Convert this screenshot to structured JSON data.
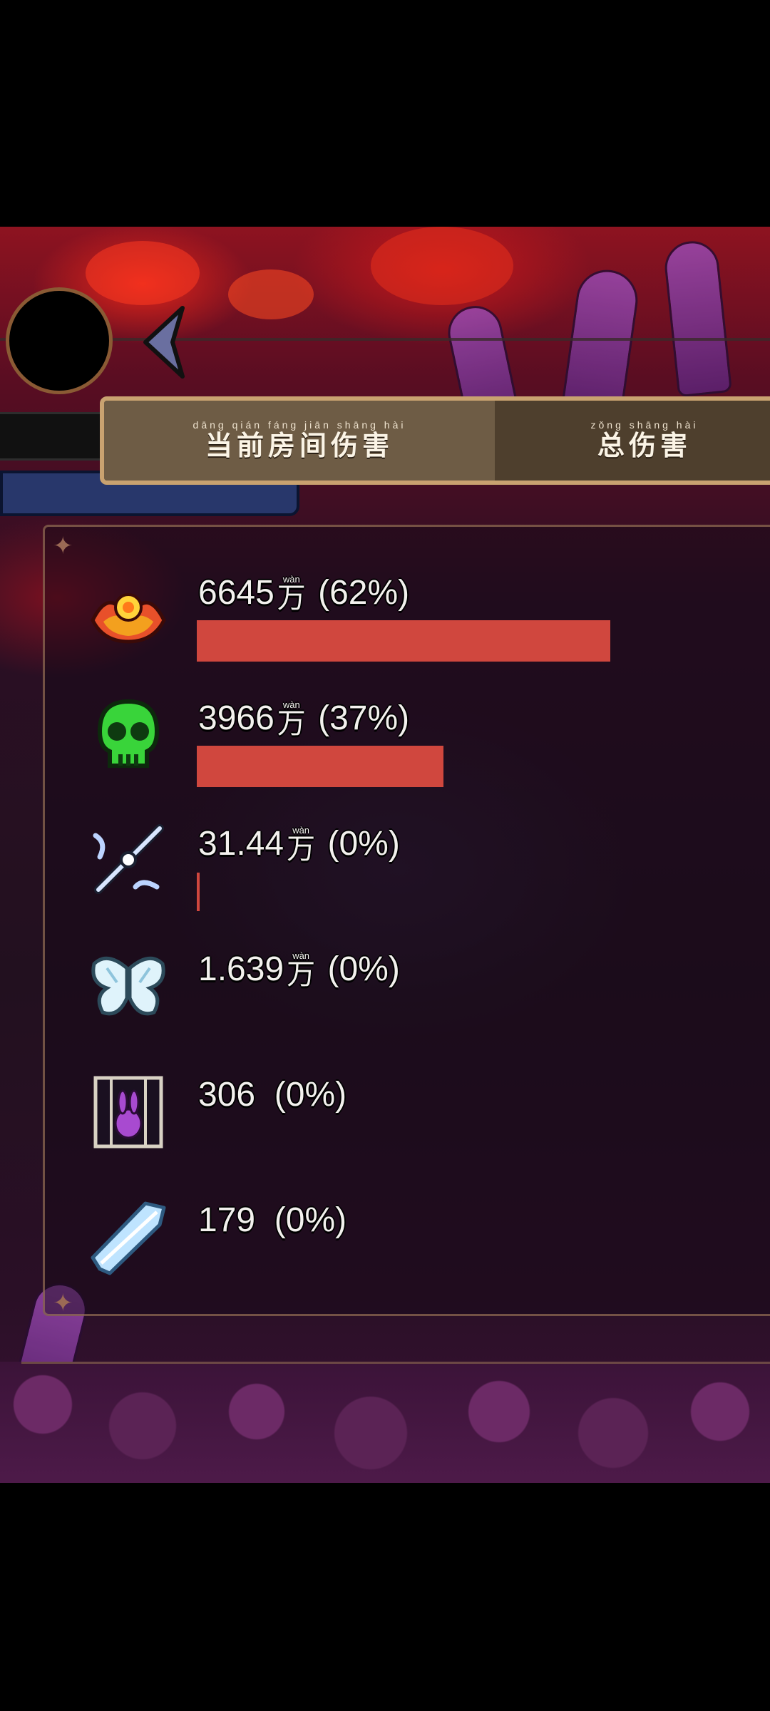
{
  "tabs": {
    "current": {
      "pinyin": "dāng qián fáng jiān shāng hài",
      "label": "当前房间伤害"
    },
    "total": {
      "pinyin": "zǒng shāng hài",
      "label": "总伤害"
    }
  },
  "unit": {
    "pinyin": "wàn",
    "char": "万"
  },
  "entries": [
    {
      "icon": "fire-flower-icon",
      "value": "6645",
      "unit": true,
      "percent": "(62%)",
      "share": 0.62
    },
    {
      "icon": "green-skull-icon",
      "value": "3966",
      "unit": true,
      "percent": "(37%)",
      "share": 0.37
    },
    {
      "icon": "crossed-blades-icon",
      "value": "31.44",
      "unit": true,
      "percent": "(0%)",
      "share": 0.003
    },
    {
      "icon": "butterfly-wings-icon",
      "value": "1.639",
      "unit": true,
      "percent": "(0%)",
      "share": 0.0
    },
    {
      "icon": "caged-rabbit-icon",
      "value": "306",
      "unit": false,
      "percent": "(0%)",
      "share": 0.0
    },
    {
      "icon": "ice-shard-icon",
      "value": "179",
      "unit": false,
      "percent": "(0%)",
      "share": 0.0
    }
  ]
}
